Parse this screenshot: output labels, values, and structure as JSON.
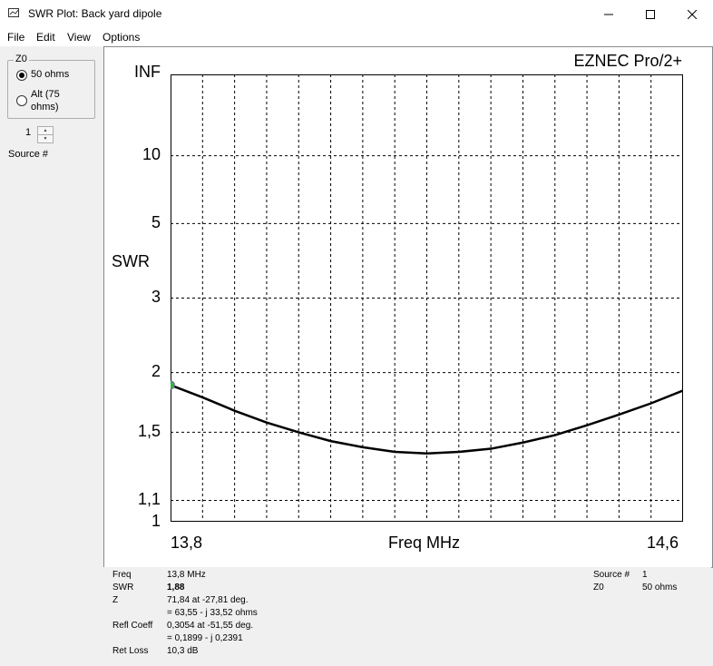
{
  "window": {
    "title": "SWR Plot: Back yard dipole"
  },
  "menu": [
    "File",
    "Edit",
    "View",
    "Options"
  ],
  "sidebar": {
    "z0_group_label": "Z0",
    "radio_50": "50 ohms",
    "radio_alt_line1": "Alt (75",
    "radio_alt_line2": "ohms)",
    "source_value": "1",
    "source_label": "Source #"
  },
  "plot": {
    "brand": "EZNEC Pro/2+",
    "ylabel": "SWR",
    "xlabel": "Freq MHz",
    "yticks": [
      "INF",
      "10",
      "5",
      "3",
      "2",
      "1,5",
      "1,1",
      "1"
    ],
    "xtick_left": "13,8",
    "xtick_right": "14,6"
  },
  "chart_data": {
    "type": "line",
    "xlabel": "Freq MHz",
    "ylabel": "SWR",
    "xlim": [
      13.8,
      14.6
    ],
    "y_scale": "reflection-coefficient (SWR)",
    "yticks": [
      "1",
      "1,1",
      "1,5",
      "2",
      "3",
      "5",
      "10",
      "INF"
    ],
    "grid": true,
    "series": [
      {
        "x": [
          13.8,
          13.85,
          13.9,
          13.95,
          14.0,
          14.05,
          14.1,
          14.15,
          14.2,
          14.25,
          14.3,
          14.35,
          14.4,
          14.45,
          14.5,
          14.55,
          14.6
        ],
        "y": [
          1.88,
          1.77,
          1.66,
          1.57,
          1.5,
          1.44,
          1.4,
          1.37,
          1.36,
          1.37,
          1.39,
          1.43,
          1.48,
          1.55,
          1.63,
          1.72,
          1.83
        ]
      }
    ],
    "marker": {
      "x": 13.8,
      "y": 1.88,
      "color": "#3cb043"
    },
    "line_color": "#000000"
  },
  "readout": {
    "rows": [
      {
        "label": "Freq",
        "value": "13,8 MHz"
      },
      {
        "label": "SWR",
        "value": "1,88"
      },
      {
        "label": "Z",
        "value": "71,84 at -27,81 deg."
      },
      {
        "label": "",
        "value": "= 63,55 - j 33,52 ohms"
      },
      {
        "label": "Refl Coeff",
        "value": "0,3054 at -51,55 deg."
      },
      {
        "label": "",
        "value": "= 0,1899 - j 0,2391"
      },
      {
        "label": "Ret Loss",
        "value": "10,3 dB"
      }
    ],
    "source_label": "Source #",
    "source_value": "1",
    "z0_label": "Z0",
    "z0_value": "50 ohms"
  }
}
